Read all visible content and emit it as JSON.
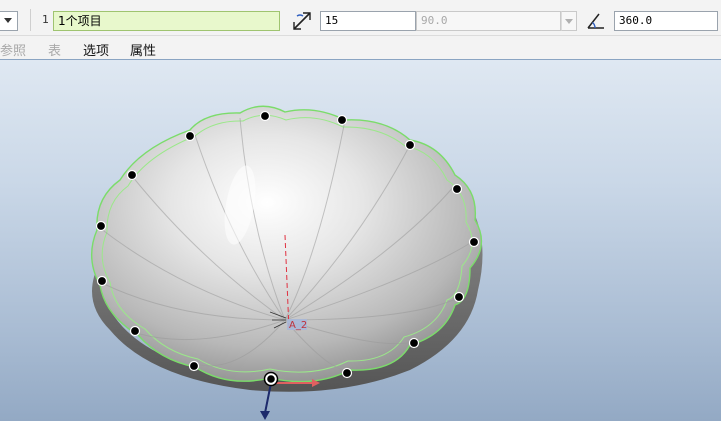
{
  "toolbar": {
    "item_index": "1",
    "items_field": "1个项目",
    "increment_value": "15",
    "disabled_value": "90.0",
    "total_angle_value": "360.0"
  },
  "tabs": [
    {
      "label": "参照",
      "enabled": false
    },
    {
      "label": "表",
      "enabled": false
    },
    {
      "label": "选项",
      "enabled": true
    },
    {
      "label": "属性",
      "enabled": true
    }
  ],
  "viewport": {
    "angle_tag": "A_2",
    "icons": [
      "increment-icon",
      "total-angle-icon",
      "axis-arrow-icon"
    ],
    "colors": {
      "highlight": "#7bdc6a",
      "dim_line": "#e03040",
      "axis": "#1d2a6b"
    }
  }
}
